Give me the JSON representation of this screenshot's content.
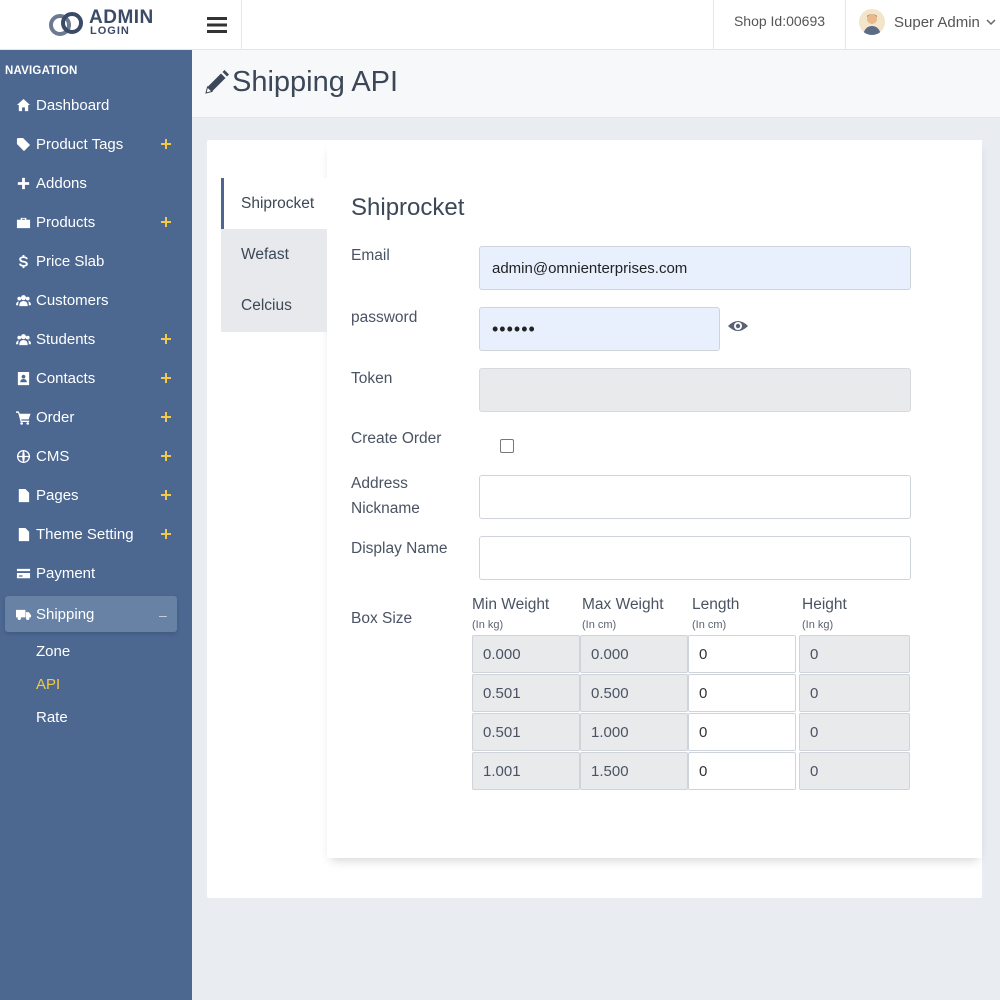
{
  "brand": {
    "line1": "ADMIN",
    "line2": "LOGIN"
  },
  "header": {
    "shop_id": "Shop Id:00693",
    "user_name": "Super Admin"
  },
  "sidebar": {
    "title": "NAVIGATION",
    "items": [
      {
        "label": "Dashboard",
        "icon": "home-icon",
        "expandable": false
      },
      {
        "label": "Product Tags",
        "icon": "tag-icon",
        "expandable": true
      },
      {
        "label": "Addons",
        "icon": "plus-icon",
        "expandable": false
      },
      {
        "label": "Products",
        "icon": "briefcase-icon",
        "expandable": true
      },
      {
        "label": "Price Slab",
        "icon": "dollar-icon",
        "expandable": false
      },
      {
        "label": "Customers",
        "icon": "users-icon",
        "expandable": false
      },
      {
        "label": "Students",
        "icon": "users-icon",
        "expandable": true
      },
      {
        "label": "Contacts",
        "icon": "contact-card-icon",
        "expandable": true
      },
      {
        "label": "Order",
        "icon": "cart-icon",
        "expandable": true
      },
      {
        "label": "CMS",
        "icon": "globe-icon",
        "expandable": true
      },
      {
        "label": "Pages",
        "icon": "file-icon",
        "expandable": true
      },
      {
        "label": "Theme Setting",
        "icon": "file-icon",
        "expandable": true
      },
      {
        "label": "Payment",
        "icon": "credit-card-icon",
        "expandable": false
      },
      {
        "label": "Shipping",
        "icon": "truck-icon",
        "expandable": true,
        "active": true,
        "collapse_symbol": "–"
      }
    ],
    "subitems": [
      {
        "label": "Zone"
      },
      {
        "label": "API",
        "current": true
      },
      {
        "label": "Rate"
      }
    ]
  },
  "page": {
    "title": "Shipping API"
  },
  "tabs": [
    "Shiprocket",
    "Wefast",
    "Celcius"
  ],
  "form": {
    "title": "Shiprocket",
    "email_label": "Email",
    "email_value": "admin@omnienterprises.com",
    "password_label": "password",
    "password_value": "••••••",
    "token_label": "Token",
    "token_value": "",
    "create_order_label": "Create Order",
    "create_order_checked": false,
    "address_label_1": "Address",
    "address_label_2": "Nickname",
    "address_value": "",
    "display_name_label": "Display Name",
    "display_name_value": "",
    "box_size_label": "Box Size",
    "columns": [
      {
        "name": "Min Weight",
        "unit": "(In kg)"
      },
      {
        "name": "Max Weight",
        "unit": "(In cm)"
      },
      {
        "name": "Length",
        "unit": "(In cm)"
      },
      {
        "name": "Height",
        "unit": "(In kg)"
      }
    ],
    "rows": [
      [
        "0.000",
        "0.000",
        "0",
        "0"
      ],
      [
        "0.501",
        "0.500",
        "0",
        "0"
      ],
      [
        "0.501",
        "1.000",
        "0",
        "0"
      ],
      [
        "1.001",
        "1.500",
        "0",
        "0"
      ]
    ]
  },
  "colors": {
    "sidebar": "#4c6891",
    "active_item": "#6882a6",
    "accent": "#f3c94b"
  }
}
